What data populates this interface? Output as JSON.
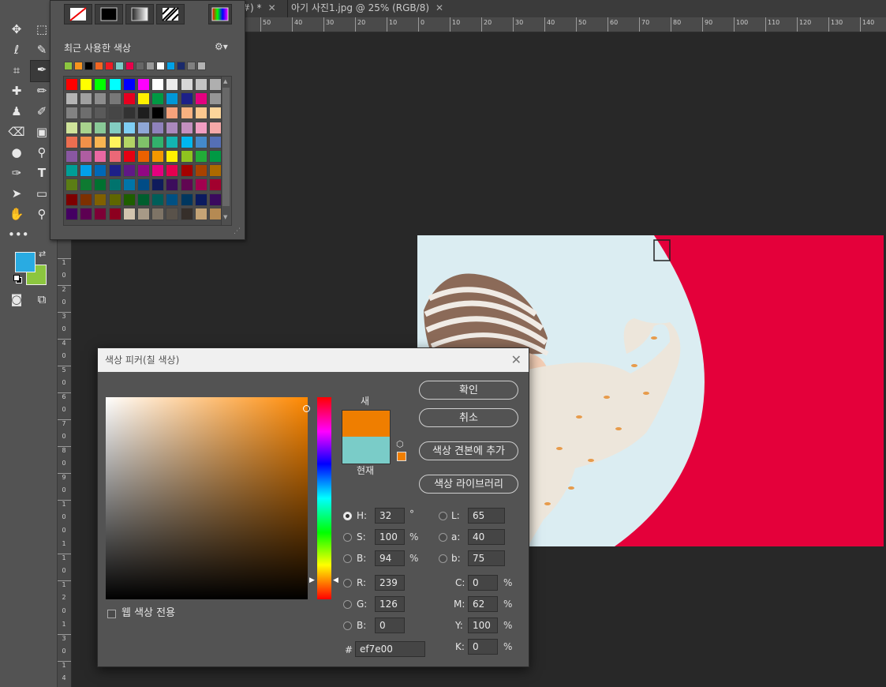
{
  "tabs": [
    {
      "label": "#) *"
    },
    {
      "label": "아기 사진1.jpg @ 25% (RGB/8)"
    }
  ],
  "ruler_h": [
    "50",
    "40",
    "30",
    "20",
    "10",
    "0",
    "10",
    "20",
    "30",
    "40",
    "50",
    "60",
    "70",
    "80",
    "90",
    "100",
    "110",
    "120",
    "130",
    "140"
  ],
  "ruler_v": [
    "1",
    "0",
    "2",
    "0",
    "3",
    "0",
    "4",
    "0",
    "5",
    "0",
    "6",
    "0",
    "7",
    "0",
    "8",
    "0",
    "9",
    "0",
    "1",
    "0",
    "0",
    "1",
    "1",
    "0",
    "1",
    "2",
    "0",
    "1",
    "3",
    "0",
    "1",
    "4"
  ],
  "swatches": {
    "recent_title": "최근 사용한 색상",
    "recent": [
      "#8cc63f",
      "#f7941d",
      "#000000",
      "#f26522",
      "#ed1c24",
      "#7accc8",
      "#e6004c",
      "#666666",
      "#999999",
      "#ffffff",
      "#00a2e8",
      "#1b2a6b",
      "#808080",
      "#b3b3b3"
    ],
    "grid": [
      [
        "#ff0000",
        "#ffff00",
        "#00ff00",
        "#00ffff",
        "#0000ff",
        "#ff00ff",
        "#ffffff",
        "#ebebeb",
        "#d7d7d7",
        "#c3c3c3",
        "#afafaf"
      ],
      [
        "#b4b4b4",
        "#a0a0a0",
        "#8c8c8c",
        "#787878",
        "#e6001f",
        "#fff100",
        "#009944",
        "#0097d7",
        "#1d2088",
        "#e4007f",
        "#969696"
      ],
      [
        "#828282",
        "#6e6e6e",
        "#5a5a5a",
        "#464646",
        "#323232",
        "#1e1e1e",
        "#000000",
        "#f7a27b",
        "#f8b180",
        "#fbc78e",
        "#fdd59a"
      ],
      [
        "#cfe39a",
        "#a8d38d",
        "#89c997",
        "#83cdc1",
        "#7ecef4",
        "#8fa7d6",
        "#8f82bc",
        "#aa89bd",
        "#c490bf",
        "#f19ec2",
        "#f5a9a8"
      ],
      [
        "#eb6e50",
        "#f19149",
        "#f8b551",
        "#fff45c",
        "#b3d465",
        "#80c269",
        "#32b16c",
        "#13b5b1",
        "#00b7ee",
        "#448aca",
        "#556fb5"
      ],
      [
        "#8957a1",
        "#ae5da1",
        "#ea68a2",
        "#eb6877",
        "#e60012",
        "#eb6100",
        "#f39800",
        "#fff100",
        "#8fc31f",
        "#22ac38",
        "#009944"
      ],
      [
        "#009e96",
        "#00a0e9",
        "#0068b7",
        "#1d2088",
        "#601986",
        "#920783",
        "#e4007f",
        "#e5004f",
        "#a40000",
        "#a84200",
        "#ac6a00"
      ],
      [
        "#5b7d15",
        "#0e7a31",
        "#007130",
        "#00736d",
        "#0075a9",
        "#004c86",
        "#0f1b5c",
        "#3c0d5c",
        "#610652",
        "#a2004f",
        "#a2002e"
      ],
      [
        "#7d0000",
        "#7d3000",
        "#806000",
        "#5f6600",
        "#1e5e00",
        "#005e2e",
        "#005e59",
        "#005082",
        "#00375f",
        "#0b1a5f",
        "#3a0a5e"
      ],
      [
        "#440062",
        "#5d0052",
        "#7d0036",
        "#8c001f",
        "#d2c4ae",
        "#a79a87",
        "#7e7466",
        "#59524a",
        "#362f2a",
        "#c5a476",
        "#b58a53"
      ]
    ]
  },
  "colors": {
    "fg": "#29abe2",
    "bg": "#8cc63f",
    "red": "#e4003a",
    "new": "#ef7e00",
    "current": "#7accc8"
  },
  "dialog": {
    "title": "색상 피커(칠 색상)",
    "ok": "확인",
    "cancel": "취소",
    "add_swatch": "색상 견본에 추가",
    "libraries": "색상 라이브러리",
    "new_label": "새",
    "current_label": "현재",
    "web_only": "웹 색상 전용",
    "hsb": [
      {
        "label": "H:",
        "value": "32",
        "unit": "°"
      },
      {
        "label": "S:",
        "value": "100",
        "unit": "%"
      },
      {
        "label": "B:",
        "value": "94",
        "unit": "%"
      }
    ],
    "rgb": [
      {
        "label": "R:",
        "value": "239"
      },
      {
        "label": "G:",
        "value": "126"
      },
      {
        "label": "B:",
        "value": "0"
      }
    ],
    "lab": [
      {
        "label": "L:",
        "value": "65"
      },
      {
        "label": "a:",
        "value": "40"
      },
      {
        "label": "b:",
        "value": "75"
      }
    ],
    "cmyk": [
      {
        "label": "C:",
        "value": "0",
        "unit": "%"
      },
      {
        "label": "M:",
        "value": "62",
        "unit": "%"
      },
      {
        "label": "Y:",
        "value": "100",
        "unit": "%"
      },
      {
        "label": "K:",
        "value": "0",
        "unit": "%"
      }
    ],
    "hex_label": "#",
    "hex": "ef7e00"
  }
}
